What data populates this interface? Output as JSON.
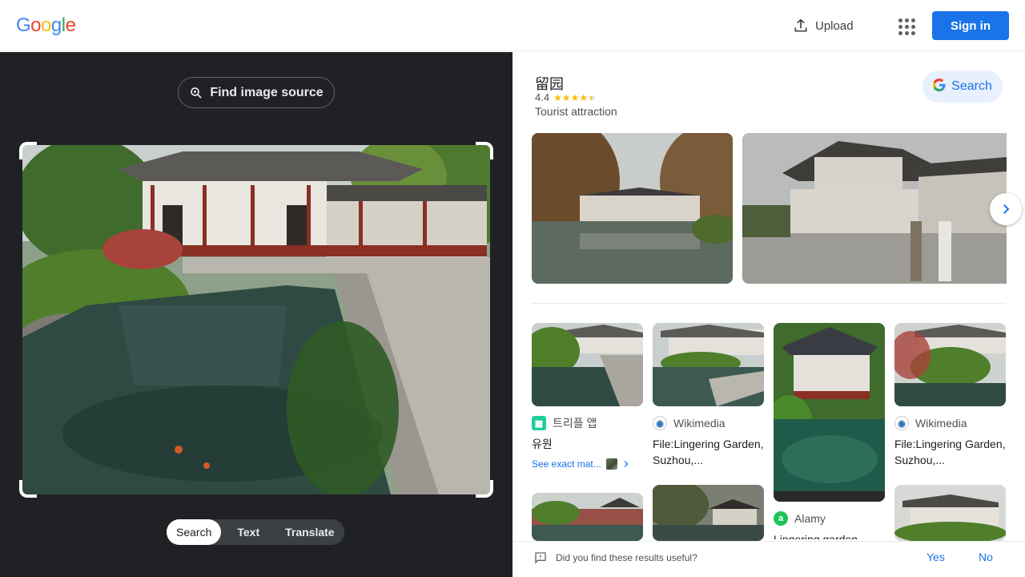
{
  "header": {
    "logo_letters": [
      {
        "ch": "G",
        "color": "#4285f4"
      },
      {
        "ch": "o",
        "color": "#ea4335"
      },
      {
        "ch": "o",
        "color": "#fbbc05"
      },
      {
        "ch": "g",
        "color": "#4285f4"
      },
      {
        "ch": "l",
        "color": "#34a853"
      },
      {
        "ch": "e",
        "color": "#ea4335"
      }
    ],
    "upload_label": "Upload",
    "apps_icon": "apps-grid-icon",
    "signin_label": "Sign in"
  },
  "left": {
    "find_source_label": "Find image source",
    "modes": [
      "Search",
      "Text",
      "Translate"
    ],
    "active_mode": "Search"
  },
  "knowledge_panel": {
    "title": "留园",
    "rating": "4.4",
    "rating_stars": 4.4,
    "subtitle": "Tourist attraction",
    "search_label": "Search"
  },
  "results": [
    {
      "source": "트리플 앱",
      "source_color": "#1ecd9b",
      "source_icon": "triple-app-icon",
      "title": "유원",
      "exact_label": "See exact mat..."
    },
    {
      "source": "Wikimedia",
      "source_color": "#2a6fb8",
      "source_icon": "wikimedia-icon",
      "title": "File:Lingering Garden, Suzhou,..."
    },
    {
      "source": "Alamy",
      "source_color": "#1dc35a",
      "source_icon": "alamy-icon",
      "title": "Lingering garden"
    },
    {
      "source": "Wikimedia",
      "source_color": "#2a6fb8",
      "source_icon": "wikimedia-icon",
      "title": "File:Lingering Garden, Suzhou,..."
    }
  ],
  "feedback": {
    "question": "Did you find these results useful?",
    "yes": "Yes",
    "no": "No"
  },
  "colors": {
    "accent": "#1a73e8",
    "dark_panel": "#202124"
  }
}
